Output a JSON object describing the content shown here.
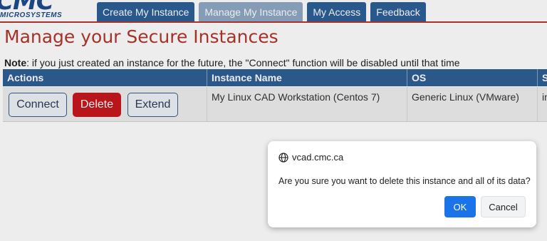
{
  "header": {
    "logo_text": "CMC",
    "logo_subtext": "MICROSYSTEMS",
    "brand_color": "#1d4c8c"
  },
  "tabs": [
    {
      "label": "Create My Instance",
      "active": false
    },
    {
      "label": "Manage My Instance",
      "active": true
    },
    {
      "label": "My Access",
      "active": false
    },
    {
      "label": "Feedback",
      "active": false
    }
  ],
  "page": {
    "title": "Manage your Secure Instances",
    "note_prefix": "Note",
    "note_text": ": if you just created an instance for the future, the \"Connect\" function will be disabled until that time"
  },
  "table": {
    "headers": [
      "Actions",
      "Instance Name",
      "OS",
      "S"
    ],
    "rows": [
      {
        "actions": [
          "Connect",
          "Delete",
          "Extend"
        ],
        "instance_name": "My Linux CAD Workstation (Centos 7)",
        "os": "Generic Linux (VMware)",
        "status_partial": "in"
      }
    ]
  },
  "dialog": {
    "origin": "vcad.cmc.ca",
    "message": "Are you sure you want to delete this instance and all of its data?",
    "ok_label": "OK",
    "cancel_label": "Cancel",
    "icon": "globe-icon"
  },
  "colors": {
    "accent_red": "#b3352c",
    "header_blue": "#2f5f95",
    "delete_red": "#c8181e",
    "ok_blue": "#1a73e8"
  }
}
